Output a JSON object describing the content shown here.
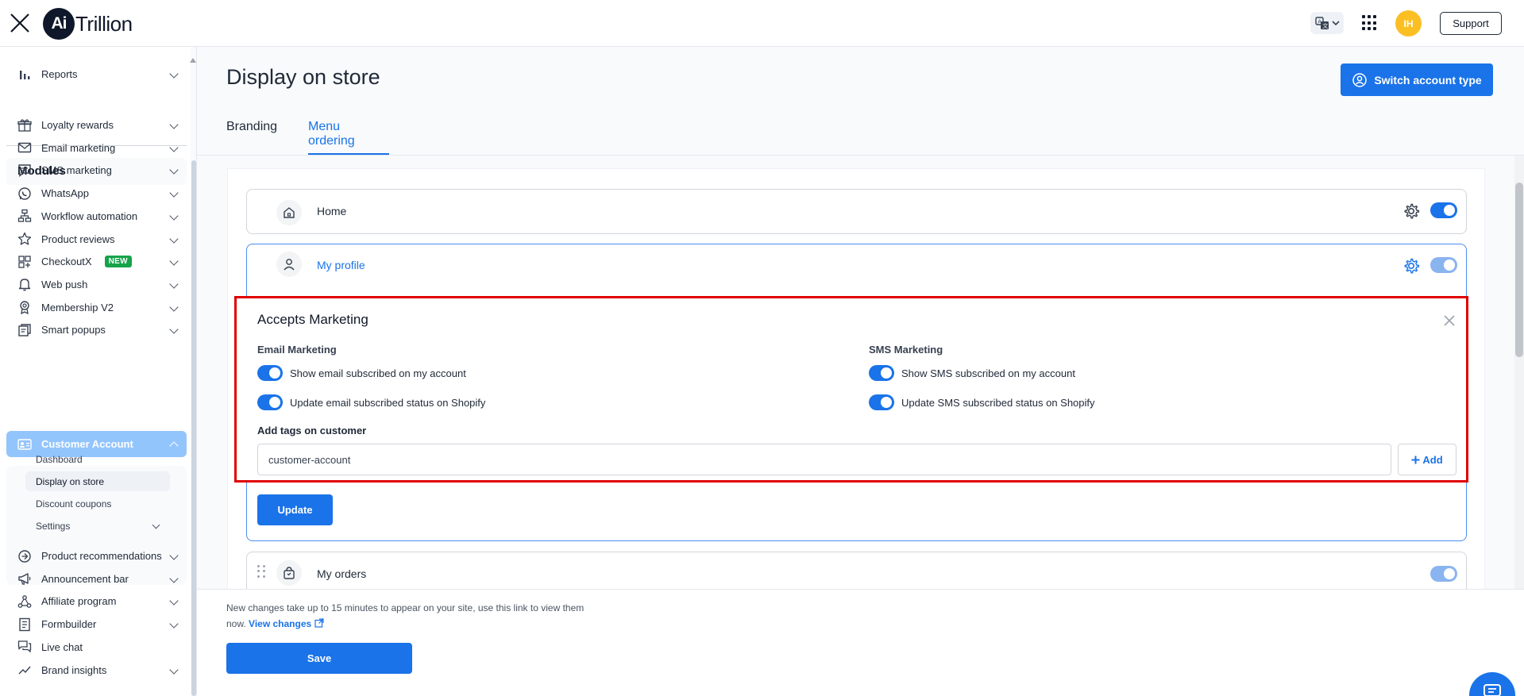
{
  "app": {
    "logo_badge": "Ai",
    "logo_text": "Trillion",
    "avatar_initials": "IH",
    "support_label": "Support"
  },
  "sidebar": {
    "reports_label": "Reports",
    "section_title": "Modules",
    "items": [
      {
        "label": "Loyalty rewards",
        "icon": "gift-icon"
      },
      {
        "label": "Email marketing",
        "icon": "envelope-icon"
      },
      {
        "label": "SMS marketing",
        "icon": "chat-icon"
      },
      {
        "label": "WhatsApp",
        "icon": "whatsapp-icon"
      },
      {
        "label": "Workflow automation",
        "icon": "workflow-icon"
      },
      {
        "label": "Product reviews",
        "icon": "star-icon"
      },
      {
        "label": "CheckoutX",
        "icon": "checkout-icon",
        "badge": "NEW"
      },
      {
        "label": "Web push",
        "icon": "bell-icon"
      },
      {
        "label": "Membership V2",
        "icon": "medal-icon"
      },
      {
        "label": "Smart popups",
        "icon": "popup-icon"
      }
    ],
    "active_item": {
      "label": "Customer Account",
      "icon": "id-card-icon"
    },
    "sub_items": [
      {
        "label": "Dashboard"
      },
      {
        "label": "Display on store"
      },
      {
        "label": "Discount coupons"
      },
      {
        "label": "Settings"
      }
    ],
    "items_after": [
      {
        "label": "Product recommendations",
        "icon": "recommend-icon"
      },
      {
        "label": "Announcement bar",
        "icon": "megaphone-icon"
      },
      {
        "label": "Affiliate program",
        "icon": "network-icon"
      },
      {
        "label": "Formbuilder",
        "icon": "form-icon"
      },
      {
        "label": "Live chat",
        "icon": "live-chat-icon"
      },
      {
        "label": "Brand insights",
        "icon": "insights-icon"
      }
    ]
  },
  "header": {
    "page_title": "Display on store",
    "switch_account_label": "Switch account type",
    "tabs": [
      {
        "label": "Branding"
      },
      {
        "label": "Menu ordering"
      }
    ]
  },
  "menu_rows": {
    "home": {
      "label": "Home",
      "enabled": true
    },
    "my_profile": {
      "label": "My profile",
      "enabled": true
    },
    "my_orders": {
      "label": "My orders",
      "enabled": true
    }
  },
  "accepts_marketing": {
    "title": "Accepts Marketing",
    "email_heading": "Email Marketing",
    "sms_heading": "SMS Marketing",
    "email_options": [
      {
        "label": "Show email subscribed on my account",
        "on": true
      },
      {
        "label": "Update email subscribed status on Shopify",
        "on": true
      }
    ],
    "sms_options": [
      {
        "label": "Show SMS subscribed on my account",
        "on": true
      },
      {
        "label": "Update SMS subscribed status on Shopify",
        "on": true
      }
    ],
    "tags_label": "Add tags on customer",
    "tags_value": "customer-account",
    "add_label": "Add",
    "update_label": "Update"
  },
  "footer": {
    "note": "New changes take up to 15 minutes to appear on your site, use this link to view them now.",
    "view_changes_label": "View changes",
    "save_label": "Save"
  },
  "colors": {
    "primary": "#1a73e8",
    "highlight_border": "#e00000",
    "new_badge": "#16a34a",
    "avatar": "#fbbf24"
  }
}
